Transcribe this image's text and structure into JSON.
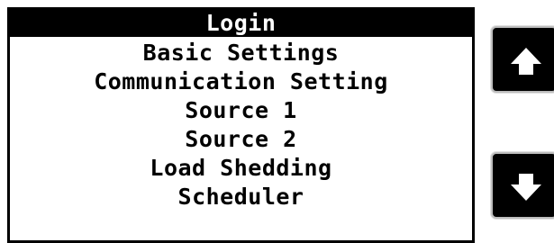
{
  "menu": {
    "items": [
      {
        "label": "Login",
        "selected": true
      },
      {
        "label": "Basic Settings",
        "selected": false
      },
      {
        "label": "Communication Setting",
        "selected": false
      },
      {
        "label": "Source 1",
        "selected": false
      },
      {
        "label": "Source 2",
        "selected": false
      },
      {
        "label": "Load Shedding",
        "selected": false
      },
      {
        "label": "Scheduler",
        "selected": false
      }
    ]
  },
  "nav": {
    "up_icon": "arrow-up-icon",
    "down_icon": "arrow-down-icon"
  },
  "colors": {
    "selected_bg": "#000000",
    "selected_text": "#ffffff",
    "text": "#000000",
    "button_bg": "#000000",
    "button_border": "#bdbdbd"
  }
}
